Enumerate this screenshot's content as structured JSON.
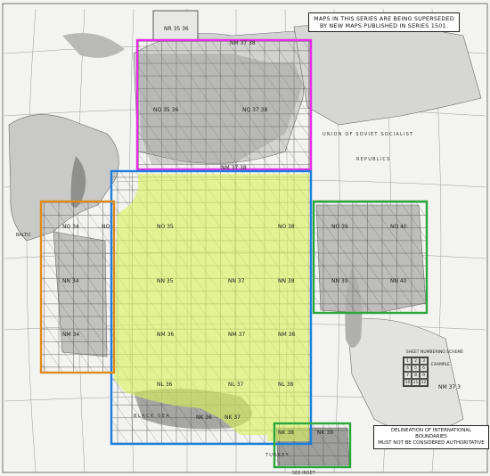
{
  "notice": {
    "line1": "MAPS IN THIS SERIES ARE BEING SUPERSEDED",
    "line2": "BY NEW MAPS PUBLISHED IN SERIES 1501."
  },
  "disclaimer": {
    "line1": "DELINEATION OF INTERNATIONAL BOUNDARIES",
    "line2": "MUST NOT BE CONSIDERED AUTHORITATIVE"
  },
  "sheet_scheme": {
    "title": "SHEET NUMBERING SCHEME",
    "example": "EXAMPLE",
    "numbers": [
      "1",
      "2",
      "3",
      "4",
      "5",
      "6",
      "7",
      "8",
      "9",
      "10",
      "11",
      "12"
    ],
    "label": "NM 37 3"
  },
  "sheet_labels": {
    "nr_35_36": "NR 35 36",
    "nr_37_38": "NM 37 38",
    "nq_35_36": "NQ 35 36",
    "nq_37_38": "NQ 37 38",
    "nn_37_38_top": "NM 37 38",
    "no_34": "NO 34",
    "no": "NO",
    "no_35": "NO 35",
    "no_38": "NO 38",
    "no_39": "NO 39",
    "no_40": "NO 40",
    "nn_34": "NN 34",
    "nn_35": "NN 35",
    "nn_37": "NN 37",
    "nn_38": "NN 38",
    "nn_39": "NN 39",
    "nn_40": "NN 40",
    "nm_34": "NM 34",
    "nm_36": "NM 36",
    "nm_37": "NM 37",
    "nm_38": "NM 38",
    "nl_36": "NL 36",
    "nl_37": "NL 37",
    "nl_38": "NL 38",
    "nk_36": "NK 36",
    "nk_37": "NK 37",
    "nk_38": "NK 38",
    "nk_39": "NK 39"
  },
  "place_labels": {
    "ussr": "UNION OF SOVIET SOCIALIST",
    "republics": "REPUBLICS",
    "black_sea": "BLACK SEA",
    "turkey": "TURKEY",
    "baltic": "BALTIC"
  },
  "bottom_label": "SEE INSET",
  "overlays": {
    "magenta": "#e62ee6",
    "blue": "#1c7fdc",
    "orange": "#e08a1c",
    "green": "#2aa63a",
    "yellow_fill": "#d8f25a"
  }
}
